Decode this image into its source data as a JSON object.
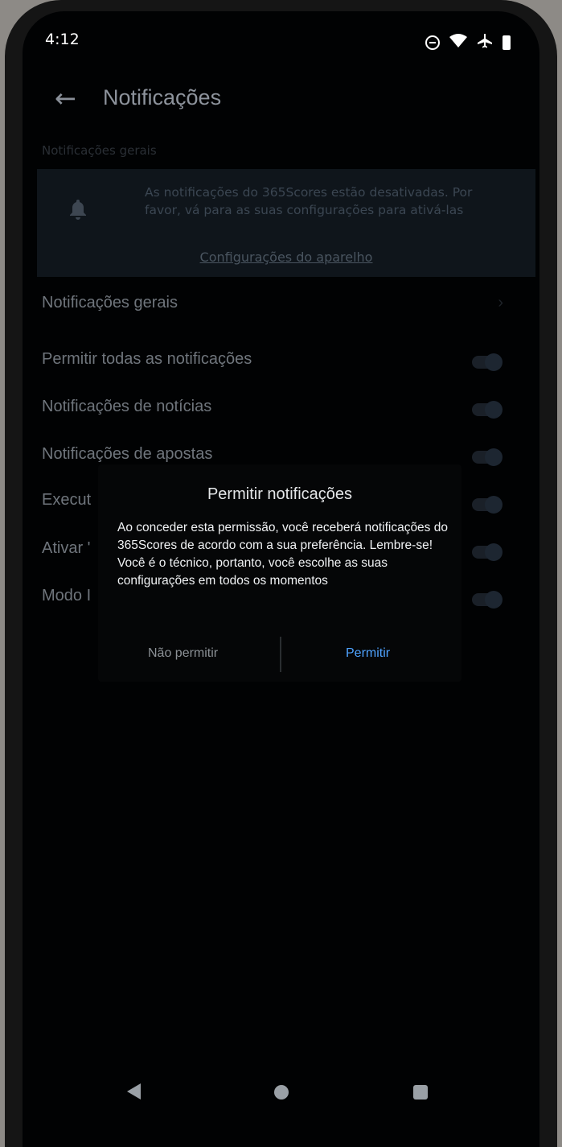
{
  "status_bar": {
    "time": "4:12",
    "icons": [
      "do-not-disturb-icon",
      "wifi-icon",
      "airplane-icon",
      "battery-icon"
    ]
  },
  "header": {
    "title": "Notificações",
    "back_icon": "arrow-left-icon"
  },
  "section_header": "Notificações gerais",
  "banner": {
    "icon": "bell-muted-icon",
    "text": "As notificações do 365Scores estão desativadas. Por favor, vá para as suas configurações para ativá-las",
    "link": "Configurações do aparelho"
  },
  "settings": {
    "general": "Notificações gerais",
    "allow_all": "Permitir todas as notificações",
    "news": "Notificações de notícias",
    "bets": "Notificações de apostas",
    "row5": "Execut",
    "row6": "Ativar '",
    "row7": "Modo I"
  },
  "dialog": {
    "title": "Permitir notificações",
    "message": "Ao conceder esta permissão, você receberá notificações do 365Scores de acordo com a sua preferência. Lembre-se! Você é o técnico, portanto, você escolhe as suas configurações em todos os momentos",
    "deny": "Não permitir",
    "allow": "Permitir"
  },
  "colors": {
    "accent": "#4fa3ff",
    "background": "#010203"
  }
}
